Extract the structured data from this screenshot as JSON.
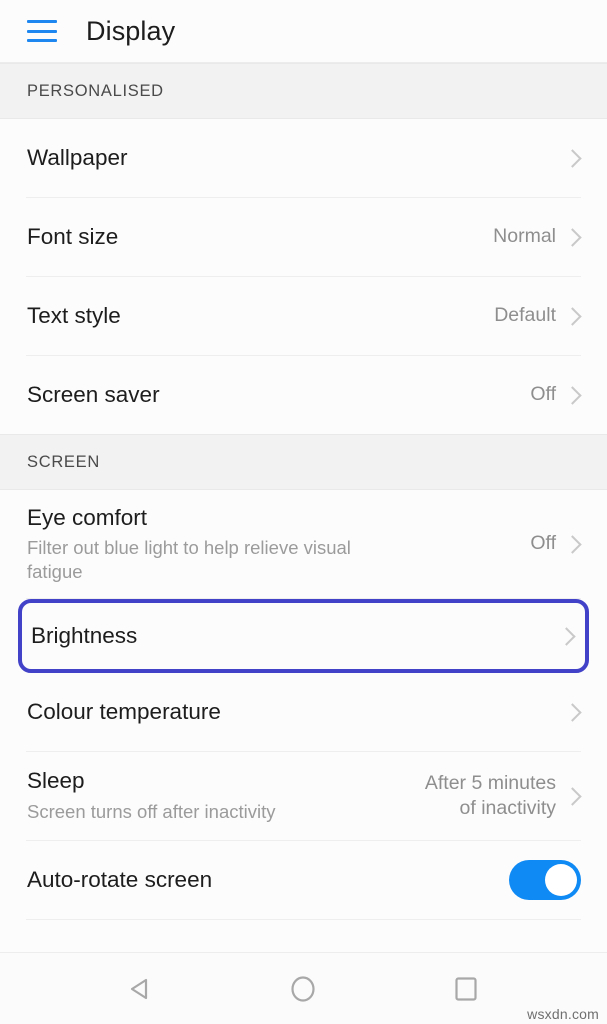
{
  "appbar": {
    "menu_icon": "hamburger-menu-icon",
    "title": "Display"
  },
  "colors": {
    "accent_blue": "#1e88f0",
    "highlight_border": "#4242c8",
    "toggle_on": "#0f8af5",
    "section_bg": "#f2f2f2",
    "page_bg": "#fcfcfc",
    "primary_text": "#1d1d1d",
    "secondary_text": "#9b9b9b",
    "chevron": "#c9c9c9"
  },
  "sections": [
    {
      "header": "PERSONALISED",
      "rows": [
        {
          "title": "Wallpaper",
          "subtitle": "",
          "value": "",
          "control": "chevron"
        },
        {
          "title": "Font size",
          "subtitle": "",
          "value": "Normal",
          "control": "chevron"
        },
        {
          "title": "Text style",
          "subtitle": "",
          "value": "Default",
          "control": "chevron"
        },
        {
          "title": "Screen saver",
          "subtitle": "",
          "value": "Off",
          "control": "chevron"
        }
      ]
    },
    {
      "header": "SCREEN",
      "rows": [
        {
          "title": "Eye comfort",
          "subtitle": "Filter out blue light to help relieve visual fatigue",
          "value": "Off",
          "control": "chevron"
        },
        {
          "title": "Brightness",
          "subtitle": "",
          "value": "",
          "control": "chevron",
          "highlighted": true
        },
        {
          "title": "Colour temperature",
          "subtitle": "",
          "value": "",
          "control": "chevron"
        },
        {
          "title": "Sleep",
          "subtitle": "Screen turns off after inactivity",
          "value": "After 5 minutes\nof inactivity",
          "control": "chevron"
        },
        {
          "title": "Auto-rotate screen",
          "subtitle": "",
          "value": "",
          "control": "toggle",
          "toggle_on": true
        }
      ]
    }
  ],
  "navbar": {
    "back": "back-triangle-icon",
    "home": "home-circle-icon",
    "recents": "recents-square-icon"
  },
  "watermark": "wsxdn.com"
}
